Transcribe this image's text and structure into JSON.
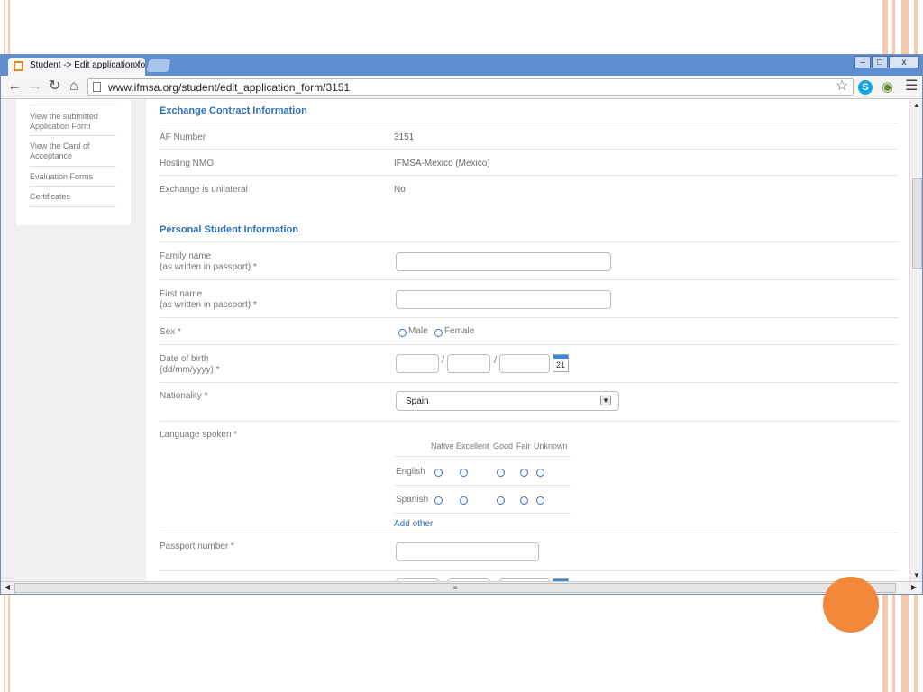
{
  "browser": {
    "tab_title": "Student -> Edit application fo",
    "tab_close": "x",
    "url": "www.ifmsa.org/student/edit_application_form/3151",
    "window_buttons": [
      "–",
      "□",
      "x"
    ],
    "icons": [
      "back-icon",
      "forward-icon",
      "reload-icon",
      "home-icon",
      "star-icon",
      "skype-icon",
      "eye-icon",
      "menu-icon"
    ]
  },
  "sidebar": {
    "items": [
      {
        "label": "View the submitted Application Form"
      },
      {
        "label": "View the Card of Acceptance"
      },
      {
        "label": "Evaluation Forms"
      },
      {
        "label": "Certificates"
      }
    ]
  },
  "exchange": {
    "title": "Exchange Contract Information",
    "rows": [
      {
        "label": "AF Number",
        "value": "3151"
      },
      {
        "label": "Hosting NMO",
        "value": "IFMSA-Mexico (Mexico)"
      },
      {
        "label": "Exchange is unilateral",
        "value": "No"
      }
    ]
  },
  "personal": {
    "title": "Personal Student Information",
    "family_name_label": "Family name",
    "family_name_sub": "(as written in passport) *",
    "first_name_label": "First name",
    "first_name_sub": "(as written in passport) *",
    "sex_label": "Sex *",
    "sex_options": [
      "Male",
      "Female"
    ],
    "dob_label": "Date of birth",
    "dob_sub": "(dd/mm/yyyy) *",
    "date_separator": "/",
    "calendar_day": "21",
    "nationality_label": "Nationality *",
    "nationality_value": "Spain",
    "language_label": "Language spoken *",
    "language_levels": [
      "Native",
      "Excellent",
      "Good",
      "Fair",
      "Unknown"
    ],
    "languages": [
      "English",
      "Spanish"
    ],
    "add_other": "Add other",
    "passport_label": "Passport number *"
  },
  "colors": {
    "accent": "#2f6db3",
    "deco": "#f6c9b0",
    "dot": "#f5873a"
  }
}
